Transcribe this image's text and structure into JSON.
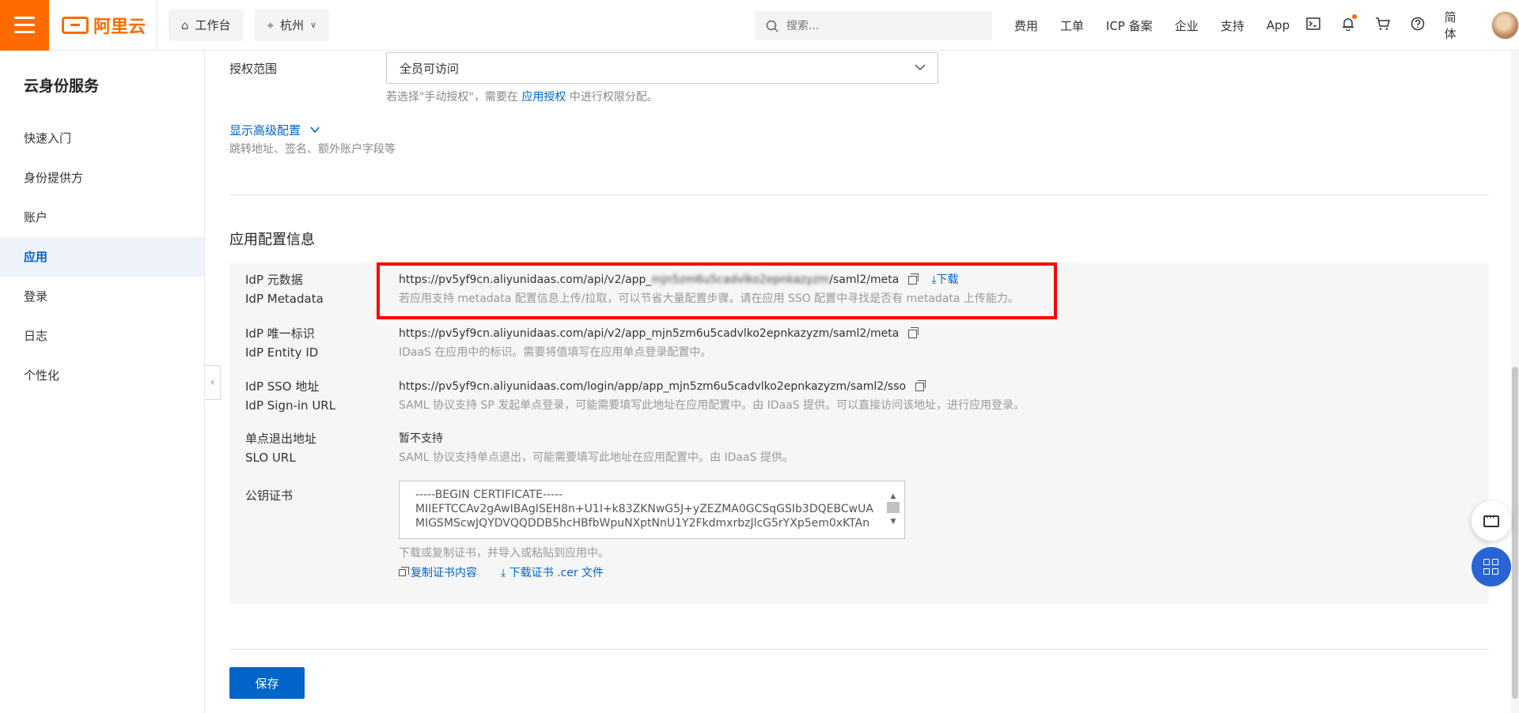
{
  "topbar": {
    "logo_text": "阿里云",
    "workbench": "工作台",
    "region": "杭州",
    "search_placeholder": "搜索...",
    "links": [
      "费用",
      "工单",
      "ICP 备案",
      "企业",
      "支持",
      "App"
    ],
    "lang": "简体",
    "icons": [
      "terminal-icon",
      "bell-icon",
      "cart-icon",
      "help-icon"
    ]
  },
  "sidebar": {
    "title": "云身份服务",
    "items": [
      {
        "label": "快速入门"
      },
      {
        "label": "身份提供方"
      },
      {
        "label": "账户"
      },
      {
        "label": "应用",
        "active": true
      },
      {
        "label": "登录"
      },
      {
        "label": "日志"
      },
      {
        "label": "个性化"
      }
    ]
  },
  "form": {
    "scope_label": "授权范围",
    "scope_value": "全员可访问",
    "scope_hint_pre": "若选择\"手动授权\"，需要在",
    "scope_hint_link": "应用授权",
    "scope_hint_post": "中进行权限分配。",
    "advanced_link": "显示高级配置",
    "advanced_desc": "跳转地址、签名、额外账户字段等"
  },
  "app_config": {
    "title": "应用配置信息",
    "metadata": {
      "label_cn": "IdP 元数据",
      "label_en": "IdP Metadata",
      "url_visible": "https://pv5yf9cn.aliyunidaas.com/api/v2/app_",
      "url_blurred": "mjn5zm6u5cadvlko2epnkazyzm",
      "url_tail": "/saml2/meta",
      "download": "下载",
      "desc": "若应用支持 metadata 配置信息上传/拉取，可以节省大量配置步骤。请在应用 SSO 配置中寻找是否有 metadata 上传能力。"
    },
    "entity_id": {
      "label_cn": "IdP 唯一标识",
      "label_en": "IdP Entity ID",
      "value": "https://pv5yf9cn.aliyunidaas.com/api/v2/app_mjn5zm6u5cadvlko2epnkazyzm/saml2/meta",
      "desc": "IDaaS 在应用中的标识。需要将值填写在应用单点登录配置中。"
    },
    "sso": {
      "label_cn": "IdP SSO 地址",
      "label_en": "IdP Sign-in URL",
      "value": "https://pv5yf9cn.aliyunidaas.com/login/app/app_mjn5zm6u5cadvlko2epnkazyzm/saml2/sso",
      "desc": "SAML 协议支持 SP 发起单点登录，可能需要填写此地址在应用配置中。由 IDaaS 提供。可以直接访问该地址，进行应用登录。"
    },
    "slo": {
      "label_cn": "单点退出地址",
      "label_en": "SLO URL",
      "value": "暂不支持",
      "desc": "SAML 协议支持单点退出，可能需要填写此地址在应用配置中。由 IDaaS 提供。"
    },
    "cert": {
      "label": "公钥证书",
      "lines": [
        "-----BEGIN CERTIFICATE-----",
        "MIIEFTCCAv2gAwIBAgISEH8n+U1I+k83ZKNwG5J+yZEZMA0GCSqGSIb3DQEBCwUA",
        "MIGSMScwJQYDVQQDDB5hcHBfbWpuNXptNnU1Y2FkdmxrbzJlcG5rYXp5em0xKTAn"
      ],
      "desc": "下载或复制证书，并导入或粘贴到应用中。",
      "copy": "复制证书内容",
      "download": "下载证书 .cer 文件"
    }
  },
  "save_label": "保存"
}
